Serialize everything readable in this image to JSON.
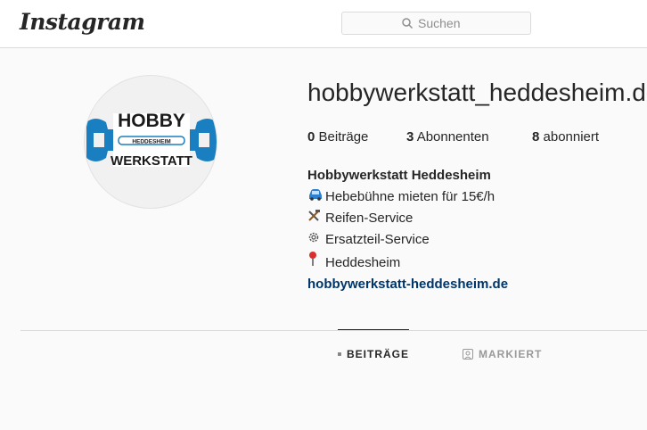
{
  "header": {
    "logo_text": "Instagram",
    "search_placeholder": "Suchen"
  },
  "profile": {
    "avatar": {
      "line1": "HOBBY",
      "band": "HEDDESHEIM",
      "line2": "WERKSTATT",
      "accent_color": "#1a7fc0"
    },
    "username": "hobbywerkstatt_heddesheim.de",
    "stats": [
      {
        "count": "0",
        "label": "Beiträge"
      },
      {
        "count": "3",
        "label": "Abonnenten"
      },
      {
        "count": "8",
        "label": "abonniert"
      }
    ],
    "bio": {
      "full_name": "Hobbywerkstatt Heddesheim",
      "lines": [
        {
          "icon": "car-icon",
          "text": "Hebebühne mieten für 15€/h"
        },
        {
          "icon": "tools-icon",
          "text": "Reifen-Service"
        },
        {
          "icon": "gear-icon",
          "text": "Ersatzteil-Service"
        },
        {
          "icon": "pin-icon",
          "text": "Heddesheim"
        }
      ],
      "website": "hobbywerkstatt-heddesheim.de"
    }
  },
  "tabs": [
    {
      "label": "BEITRÄGE",
      "icon": "grid-icon",
      "active": true
    },
    {
      "label": "MARKIERT",
      "icon": "tagged-icon",
      "active": false
    }
  ]
}
